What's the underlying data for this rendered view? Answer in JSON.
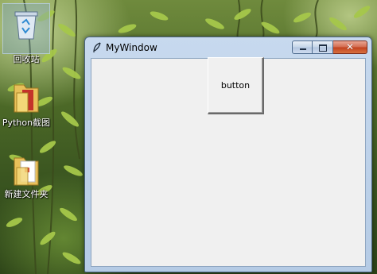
{
  "desktop": {
    "icons": [
      {
        "label": "回收站",
        "icon": "recycle-bin-icon"
      },
      {
        "label": "Python截图",
        "icon": "folder-icon"
      },
      {
        "label": "新建文件夹",
        "icon": "folder-icon"
      }
    ]
  },
  "window": {
    "title": "MyWindow",
    "icon": "feather-icon",
    "controls": [
      "minimize-icon",
      "maximize-icon",
      "close-icon"
    ],
    "button_label": "button",
    "client_bg": "#f0f0f0"
  }
}
